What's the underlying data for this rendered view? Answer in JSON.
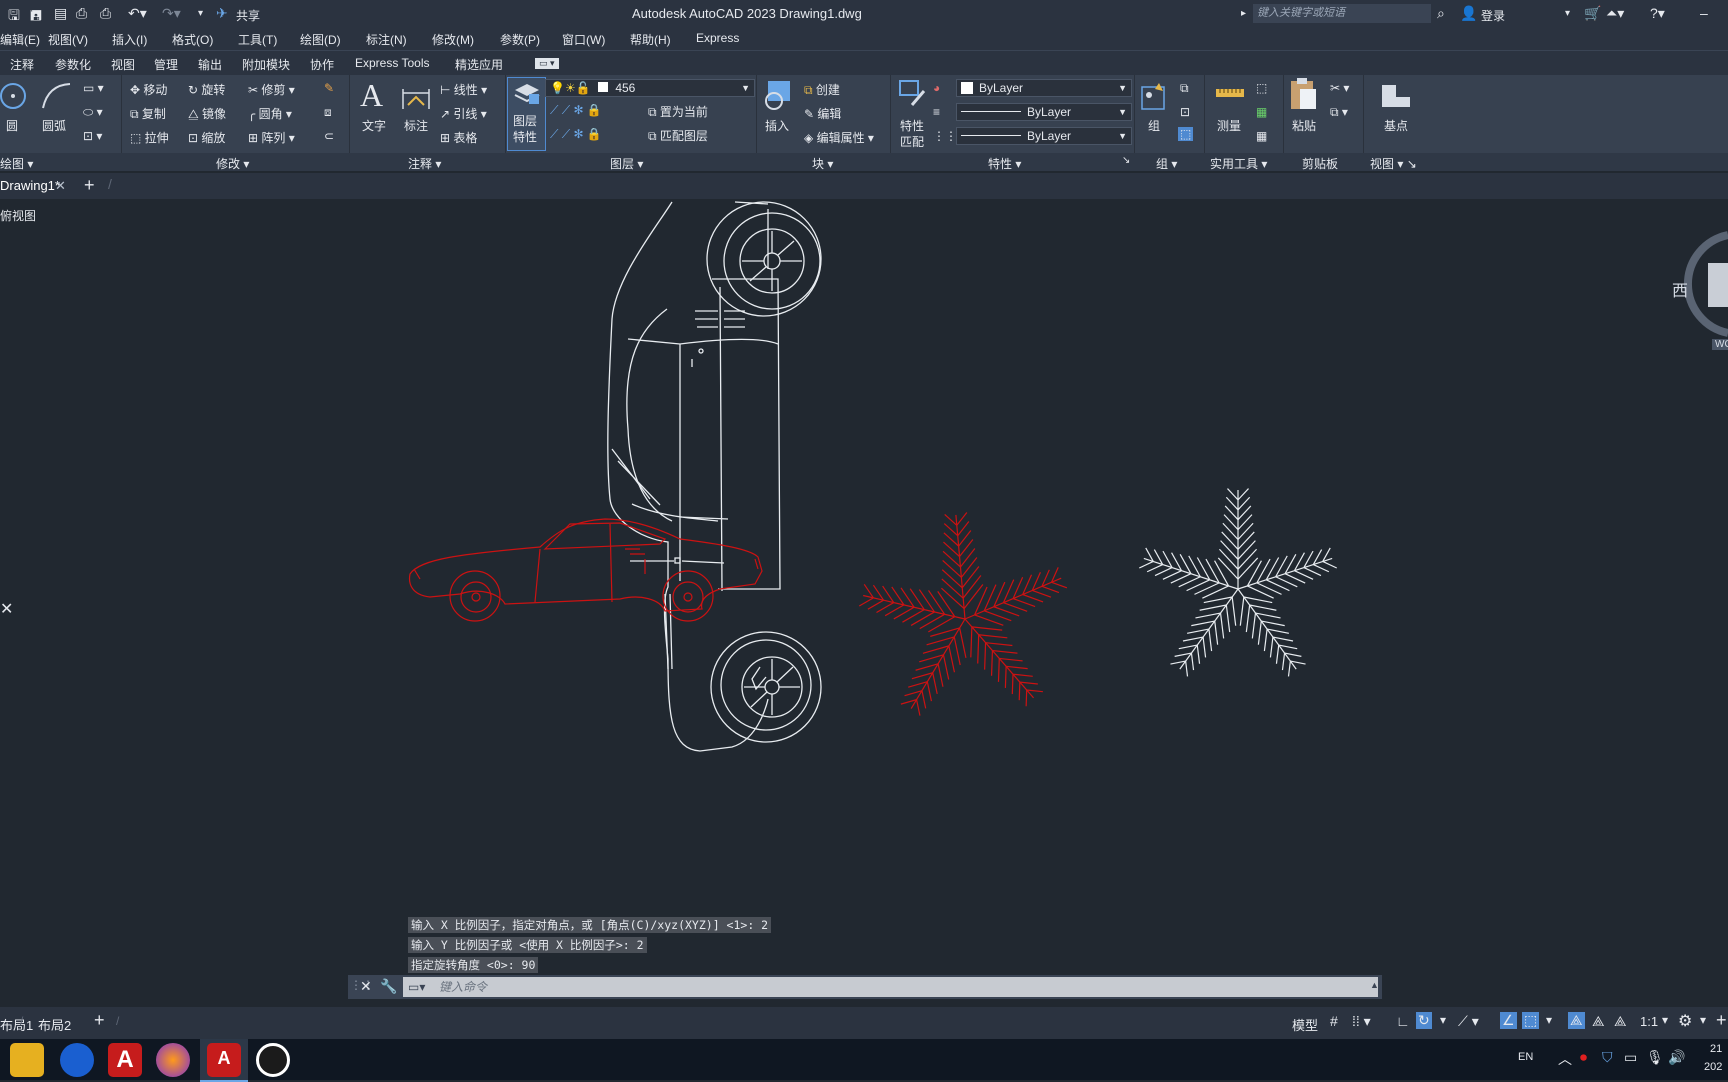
{
  "title_bar": {
    "share_label": "共享",
    "app_title": "Autodesk AutoCAD 2023    Drawing1.dwg",
    "search_placeholder": "键入关键字或短语",
    "login_label": "登录"
  },
  "menu": [
    "编辑(E)",
    "视图(V)",
    "插入(I)",
    "格式(O)",
    "工具(T)",
    "绘图(D)",
    "标注(N)",
    "修改(M)",
    "参数(P)",
    "窗口(W)",
    "帮助(H)",
    "Express"
  ],
  "ribbon_tabs": [
    "注释",
    "参数化",
    "视图",
    "管理",
    "输出",
    "附加模块",
    "协作",
    "Express Tools",
    "精选应用"
  ],
  "ribbon": {
    "draw": {
      "circle": "圆",
      "arc": "圆弧",
      "title": "绘图"
    },
    "modify": {
      "move": "移动",
      "rotate": "旋转",
      "trim": "修剪",
      "copy": "复制",
      "mirror": "镜像",
      "fillet": "圆角",
      "stretch": "拉伸",
      "scale": "缩放",
      "array": "阵列",
      "title": "修改"
    },
    "annotation": {
      "text": "文字",
      "dimension": "标注",
      "linear": "线性",
      "leader": "引线",
      "table": "表格",
      "title": "注释"
    },
    "layers": {
      "layer_props_line1": "图层",
      "layer_props_line2": "特性",
      "current_layer": "456",
      "set_current": "置为当前",
      "match_layer": "匹配图层",
      "title": "图层"
    },
    "block": {
      "insert": "插入",
      "create": "创建",
      "edit": "编辑",
      "edit_attr": "编辑属性",
      "title": "块"
    },
    "properties": {
      "match_line1": "特性",
      "match_line2": "匹配",
      "color": "ByLayer",
      "linetype": "ByLayer",
      "lineweight": "ByLayer",
      "title": "特性"
    },
    "groups": {
      "group": "组",
      "title": "组"
    },
    "utilities": {
      "measure": "测量",
      "title": "实用工具"
    },
    "clipboard": {
      "paste": "粘贴",
      "title": "剪贴板"
    },
    "view": {
      "base": "基点",
      "title": "视图"
    }
  },
  "doc_tabs": {
    "active": "Drawing1*",
    "new_tab": "+"
  },
  "viewport_label": "俯视图",
  "viewcube": {
    "west": "西",
    "wcs": "WCS"
  },
  "command_history": [
    "输入 X 比例因子，指定对角点，或 [角点(C)/xyz(XYZ)] <1>: 2",
    "输入 Y 比例因子或 <使用 X 比例因子>: 2",
    "指定旋转角度 <0>: 90"
  ],
  "command_placeholder": "键入命令",
  "layout_tabs": [
    "布局1",
    "布局2"
  ],
  "status_bar": {
    "model": "模型",
    "scale": "1:1"
  },
  "taskbar": {
    "lang": "EN",
    "clock_line1": "21",
    "clock_line2": "202"
  },
  "colors": {
    "accent": "#4f8ad1",
    "red_block": "#cc1212",
    "canvas": "#212830"
  }
}
